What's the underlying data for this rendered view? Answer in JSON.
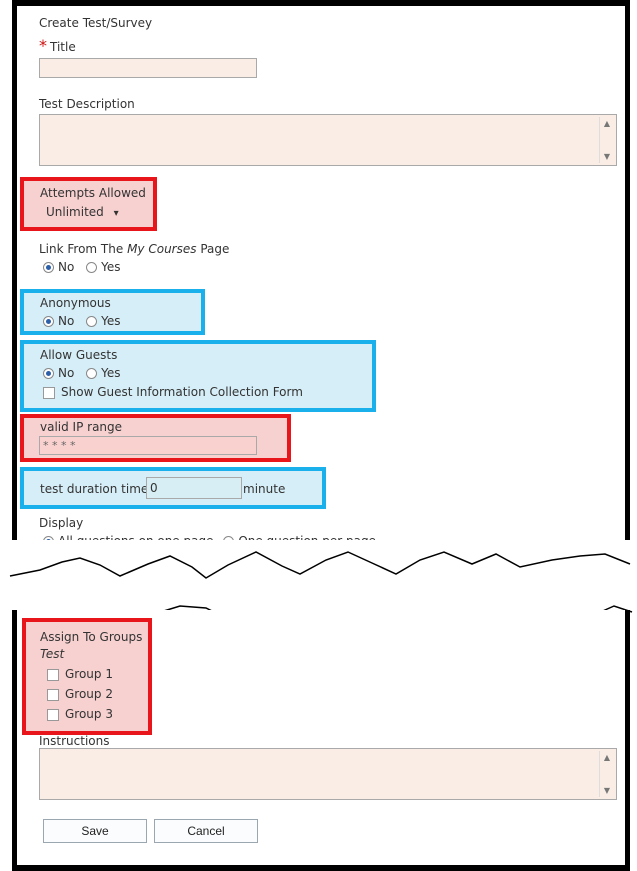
{
  "form": {
    "header": "Create Test/Survey",
    "required_mark": "*",
    "title_label": "Title",
    "description_label": "Test Description",
    "attempts": {
      "label": "Attempts Allowed",
      "value": "Unlimited",
      "arrow": "▾"
    },
    "link": {
      "label_prefix": "Link From The ",
      "label_em": "My Courses",
      "label_suffix": " Page",
      "options": [
        "No",
        "Yes"
      ],
      "selected": "No"
    },
    "anonymous": {
      "label": "Anonymous",
      "options": [
        "No",
        "Yes"
      ],
      "selected": "No"
    },
    "allow_guests": {
      "label": "Allow Guests",
      "options": [
        "No",
        "Yes"
      ],
      "selected": "No",
      "checkbox_label": "Show Guest Information Collection Form"
    },
    "ip_range": {
      "label": "valid IP range",
      "value": "* * * *"
    },
    "duration": {
      "label": "test duration time",
      "value": "0",
      "unit": "minute"
    },
    "display": {
      "label": "Display",
      "options": [
        "All questions on one page",
        "One question per page"
      ],
      "selected": "All questions on one page"
    },
    "groups": {
      "label": "Assign To Groups",
      "subheading": "Test",
      "items": [
        "Group 1",
        "Group 2",
        "Group 3"
      ]
    },
    "instructions_label": "Instructions",
    "buttons": {
      "save": "Save",
      "cancel": "Cancel"
    }
  },
  "colors": {
    "highlight_red": "#e8151b",
    "highlight_blue": "#1ab0ec",
    "field_bg": "#faede6"
  }
}
